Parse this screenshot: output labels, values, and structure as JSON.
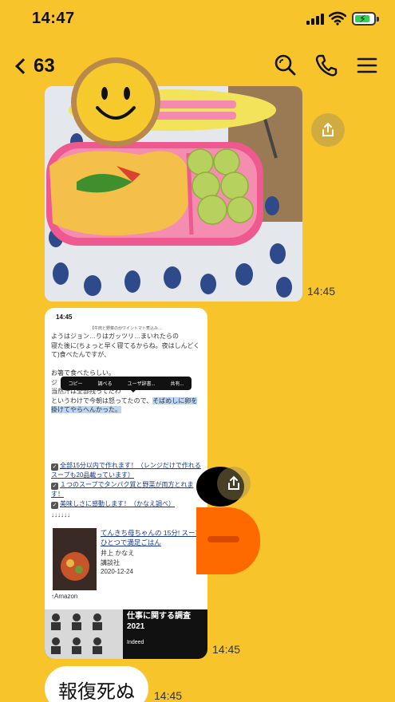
{
  "status_bar": {
    "time": "14:47"
  },
  "header": {
    "back_count": "63",
    "search_icon": "search-icon",
    "call_icon": "phone-icon",
    "menu_icon": "menu-icon"
  },
  "messages": {
    "photo": {
      "time": "14:45"
    },
    "screenshot": {
      "time": "14:45",
      "phone_time": "14:45",
      "page_title": "【牛肉と野菜の炒ワイントマト煮込み…",
      "lines": [
        "ようはジョン…りはガッツリ…まいれたらの",
        "寝た後に(ちょっと早く寝てるからね。夜はしんどく",
        "て)食べたんですが、",
        "",
        "お箸で食べたらしい。",
        "ジ",
        "当然汁は全部残ってたわ",
        "というわけで今朝は怒ってたので、",
        "掛けてやらへんかった。"
      ],
      "selected_text": "そばめしに卵を",
      "context_menu": [
        "コピー",
        "調べる",
        "ユーザ辞書...",
        "共有..."
      ],
      "links": [
        "全部15分以内で作れます！（レンジだけで作れるスープも20品載っています）",
        "１つのスープでタンパク質と野菜が両方とれます！",
        "美味しさに感動します！（かなえ調べ）"
      ],
      "arrows": "↓↓↓↓↓↓",
      "book": {
        "title": "てんきち母ちゃんの 15分! スープひとつで満足ごはん",
        "author": "井上 かなえ",
        "publisher": "講談社",
        "date": "2020-12-24",
        "source": "↑Amazon"
      },
      "ad": {
        "title": "仕事に関する調査2021",
        "sub": "Indeed"
      }
    },
    "sticker_time": "14:45",
    "text": {
      "content": "報復死ぬ",
      "time": "14:45"
    }
  },
  "colors": {
    "background": "#f7c52b",
    "bubble": "#ffffff"
  }
}
